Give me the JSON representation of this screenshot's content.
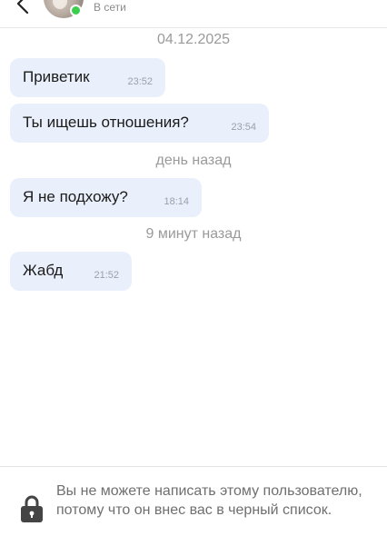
{
  "header": {
    "status": "В сети"
  },
  "messages": [
    {
      "type": "date",
      "text": "04.12.2025"
    },
    {
      "type": "message",
      "text": "Приветик",
      "time": "23:52"
    },
    {
      "type": "message",
      "text": "Ты ищешь отношения?",
      "time": "23:54"
    },
    {
      "type": "date",
      "text": "день назад"
    },
    {
      "type": "message",
      "text": "Я не подхожу?",
      "time": "18:14"
    },
    {
      "type": "date",
      "text": "9 минут назад"
    },
    {
      "type": "message",
      "text": "Жабд",
      "time": "21:52"
    }
  ],
  "footer": {
    "notice": "Вы не можете написать этому пользователю, потому что он внес вас в черный список."
  },
  "colors": {
    "bubble": "#e9f0fb",
    "online": "#3ccf4e"
  }
}
